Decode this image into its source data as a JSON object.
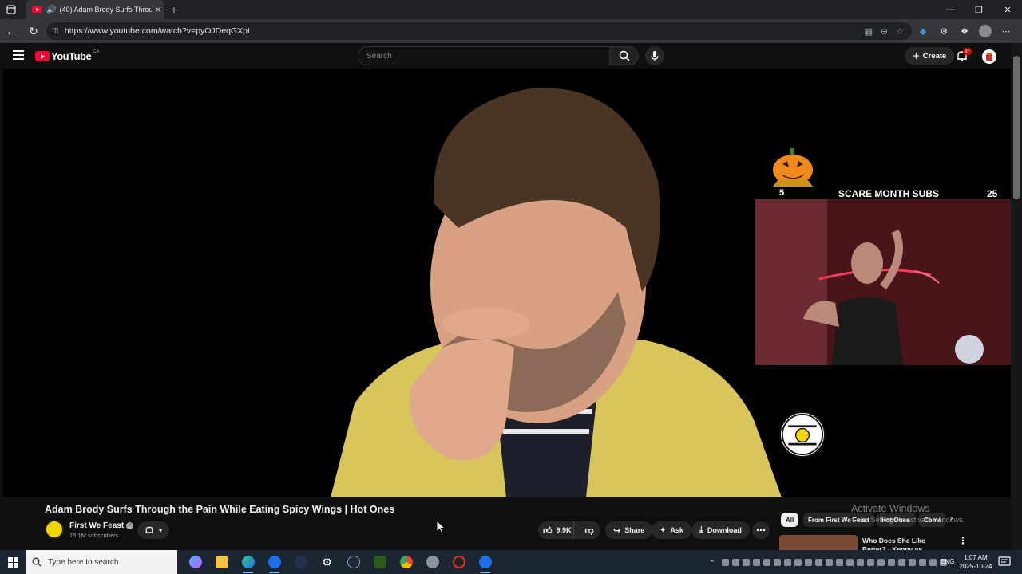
{
  "browser": {
    "tab_title": "(40) Adam Brody Surfs Throu",
    "url": "https://www.youtube.com/watch?v=pyOJDeqGXpI",
    "win_controls": [
      "—",
      "❐",
      "✕"
    ]
  },
  "youtube": {
    "logo_text": "YouTube",
    "country": "CA",
    "search_placeholder": "Search",
    "create_label": "Create",
    "notif_badge": "9+"
  },
  "video_overlay": {
    "left_count": "5",
    "title": "SCARE MONTH SUBS",
    "right_count": "25"
  },
  "video": {
    "title": "Adam Brody Surfs Through the Pain While Eating Spicy Wings | Hot Ones",
    "channel": "First We Feast",
    "subscribers": "15.1M subscribers",
    "likes": "9.9K",
    "share_label": "Share",
    "ask_label": "Ask",
    "download_label": "Download"
  },
  "sidebar": {
    "chips": [
      "All",
      "From First We Feast",
      "Hot Ones",
      "Come"
    ],
    "rec_title": "Who Does She Like Better? - Kenny vs. Spenny"
  },
  "watermark": {
    "line1": "Activate Windows",
    "line2": "Go to Settings to activate Windows."
  },
  "taskbar": {
    "search_placeholder": "Type here to search",
    "lang": "ENG",
    "time": "1:07 AM",
    "date": "2025-10-24"
  }
}
